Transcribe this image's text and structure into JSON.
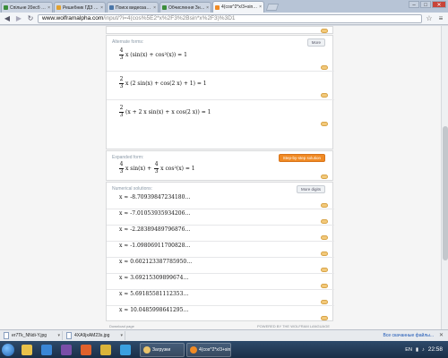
{
  "browser": {
    "tabs": [
      {
        "label": "Спільне 20есб в мидем 6 і",
        "color": "#3b8d3b"
      },
      {
        "label": "Решебник ГДЗ по алгебр...",
        "color": "#e0a030"
      },
      {
        "label": "Поиск видеозаписей по з...",
        "color": "#4a76a8"
      },
      {
        "label": "Обчислення Знаннямі - Т...",
        "color": "#3b8d3b"
      },
      {
        "label": "4(cos^2*x/3+sin^x/3)=4...",
        "color": "#f08a24",
        "active": true
      }
    ],
    "window_controls": {
      "minimize": "–",
      "maximize": "□",
      "close": "✕"
    },
    "url_host": "www.wolframalpha.com",
    "url_path": "/input/?i=4(cos%5E2*x%2F3%2Bsin*x%2F3)%3D1"
  },
  "alternate_forms": {
    "title": "Alternate forms:",
    "more_label": "More",
    "forms": [
      {
        "coef_num": "4",
        "coef_den": "3",
        "expr": "x (sin(x) + cos²(x)) = 1"
      },
      {
        "coef_num": "2",
        "coef_den": "3",
        "expr": "x (2 sin(x) + cos(2 x) + 1) = 1"
      },
      {
        "coef_num": "2",
        "coef_den": "3",
        "expr": "(x + 2 x sin(x) + x cos(2 x)) = 1"
      }
    ]
  },
  "expanded_form": {
    "title": "Expanded form:",
    "button_label": "Step-by-step solution",
    "term1_num": "4",
    "term1_den": "3",
    "term1_expr": "x sin(x) +",
    "term2_num": "4",
    "term2_den": "3",
    "term2_expr": "x cos²(x) = 1"
  },
  "numerical_solutions": {
    "title": "Numerical solutions:",
    "more_label": "More digits",
    "solutions": [
      "x ≈ -8.70939847234180…",
      "x ≈ -7.01053935934206…",
      "x ≈ -2.28389489796876…",
      "x ≈ -1.09806911700828…",
      "x ≈ 0.602123387785950…",
      "x ≈ 3.69215309899674…",
      "x ≈ 5.69185581112353…",
      "x ≈ 10.0485998641295…"
    ]
  },
  "page_footer": {
    "left": "Download page",
    "right": "POWERED BY THE WOLFRAM LANGUAGE"
  },
  "downloads": {
    "items": [
      {
        "name": "er7Tk_NNdi-Y.jpg"
      },
      {
        "name": "4XA9jxAM23s.jpg"
      }
    ],
    "show_all": "Все скачанные файлы..."
  },
  "taskbar": {
    "apps": [
      {
        "color": "#e8c14a"
      },
      {
        "color": "#3a86d6"
      },
      {
        "color": "#7a4ea8"
      },
      {
        "color": "#e0612c"
      },
      {
        "color": "#d9b43a"
      },
      {
        "color": "#3aa0e0"
      }
    ],
    "windows": [
      {
        "label": "Загрузки",
        "color": "#e9c36b"
      },
      {
        "label": "4(cos^2*x/3+sin...",
        "color": "#f08a24"
      }
    ],
    "language": "EN",
    "clock": "22:58"
  }
}
